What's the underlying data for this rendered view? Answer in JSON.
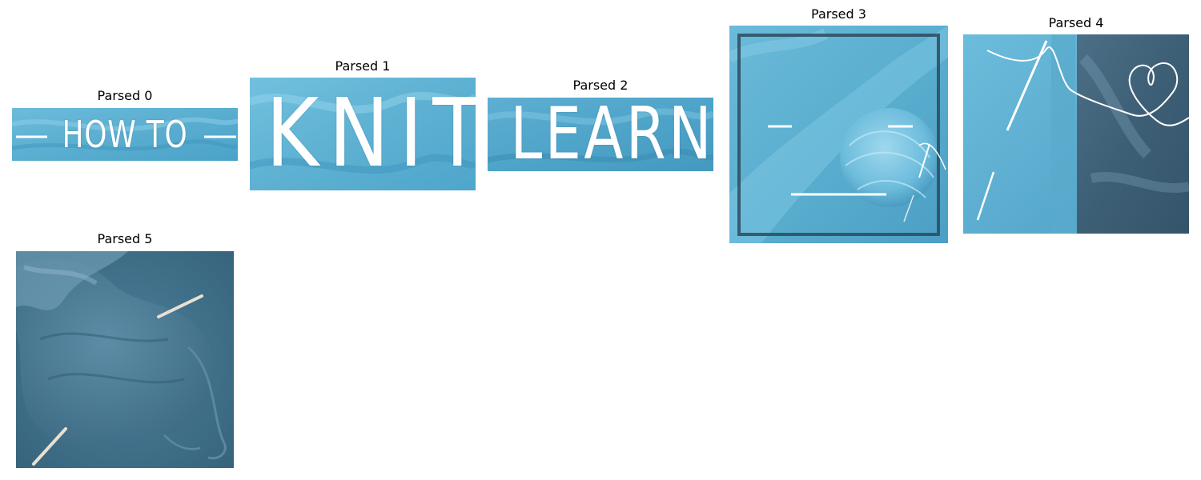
{
  "panels": [
    {
      "title": "Parsed 0",
      "text": "HOW TO"
    },
    {
      "title": "Parsed 1",
      "text": "KNIT"
    },
    {
      "title": "Parsed 2",
      "text": "LEARN"
    },
    {
      "title": "Parsed 3"
    },
    {
      "title": "Parsed 4"
    },
    {
      "title": "Parsed 5"
    }
  ],
  "colors": {
    "yarn_light_blue": "#5fb3d4",
    "yarn_blue_dark": "#3a8db3",
    "frame_dark": "#2d4a5e",
    "white_line": "#ffffff",
    "knit_teal": "#3f6d86"
  }
}
